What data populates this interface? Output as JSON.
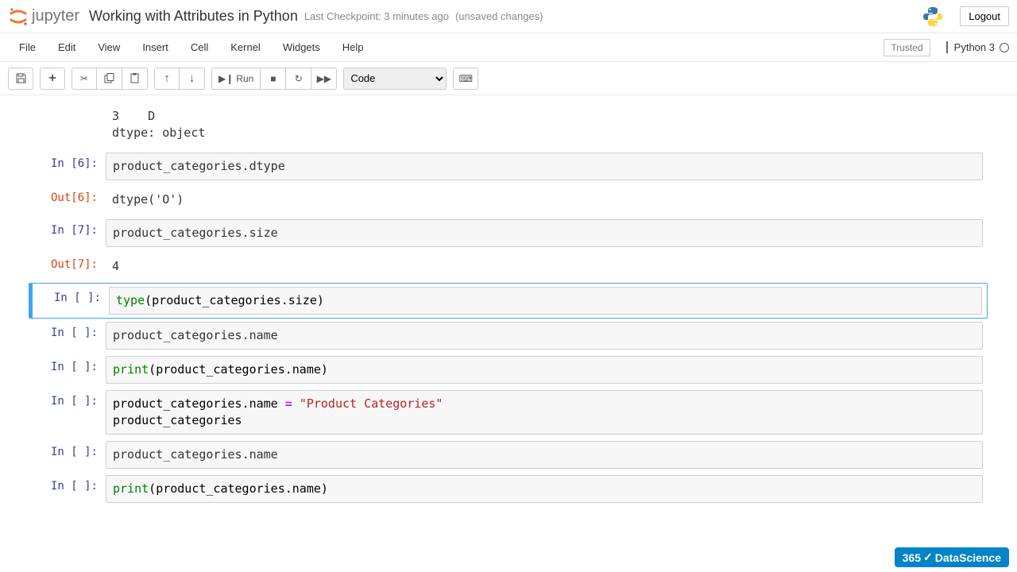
{
  "header": {
    "logo_text": "jupyter",
    "notebook_name": "Working with Attributes in Python",
    "checkpoint": "Last Checkpoint: 3 minutes ago",
    "autosave": "(unsaved changes)",
    "logout": "Logout"
  },
  "menu": {
    "items": [
      "File",
      "Edit",
      "View",
      "Insert",
      "Cell",
      "Kernel",
      "Widgets",
      "Help"
    ],
    "trusted": "Trusted",
    "kernel": "Python 3"
  },
  "toolbar": {
    "run_label": "Run",
    "cell_type": "Code"
  },
  "cells": [
    {
      "type": "output_continuation",
      "output": "3    D\ndtype: object"
    },
    {
      "type": "code",
      "in_num": "6",
      "code": "product_categories.dtype",
      "out_num": "6",
      "output": "dtype('O')"
    },
    {
      "type": "code",
      "in_num": "7",
      "code": "product_categories.size",
      "out_num": "7",
      "output": "4"
    },
    {
      "type": "code",
      "in_num": " ",
      "selected": true,
      "code_tokens": [
        {
          "t": "type",
          "c": "bn"
        },
        {
          "t": "(",
          "c": "nm"
        },
        {
          "t": "product_categories",
          "c": "nm"
        },
        {
          "t": ".",
          "c": "nm"
        },
        {
          "t": "size",
          "c": "nm"
        },
        {
          "t": ")",
          "c": "nm"
        }
      ]
    },
    {
      "type": "code",
      "in_num": " ",
      "code": "product_categories.name"
    },
    {
      "type": "code",
      "in_num": " ",
      "code_tokens": [
        {
          "t": "print",
          "c": "bn"
        },
        {
          "t": "(",
          "c": "nm"
        },
        {
          "t": "product_categories",
          "c": "nm"
        },
        {
          "t": ".",
          "c": "nm"
        },
        {
          "t": "name",
          "c": "nm"
        },
        {
          "t": ")",
          "c": "nm"
        }
      ]
    },
    {
      "type": "code",
      "in_num": " ",
      "code_tokens": [
        {
          "t": "product_categories",
          "c": "nm"
        },
        {
          "t": ".",
          "c": "nm"
        },
        {
          "t": "name ",
          "c": "nm"
        },
        {
          "t": "=",
          "c": "op"
        },
        {
          "t": " ",
          "c": "nm"
        },
        {
          "t": "\"Product Categories\"",
          "c": "str"
        },
        {
          "t": "\nproduct_categories",
          "c": "nm"
        }
      ]
    },
    {
      "type": "code",
      "in_num": " ",
      "code": "product_categories.name"
    },
    {
      "type": "code",
      "in_num": " ",
      "code_tokens": [
        {
          "t": "print",
          "c": "bn"
        },
        {
          "t": "(",
          "c": "nm"
        },
        {
          "t": "product_categories",
          "c": "nm"
        },
        {
          "t": ".",
          "c": "nm"
        },
        {
          "t": "name",
          "c": "nm"
        },
        {
          "t": ")",
          "c": "nm"
        }
      ]
    }
  ],
  "watermark": {
    "brand": "365",
    "suffix": "DataScience"
  }
}
